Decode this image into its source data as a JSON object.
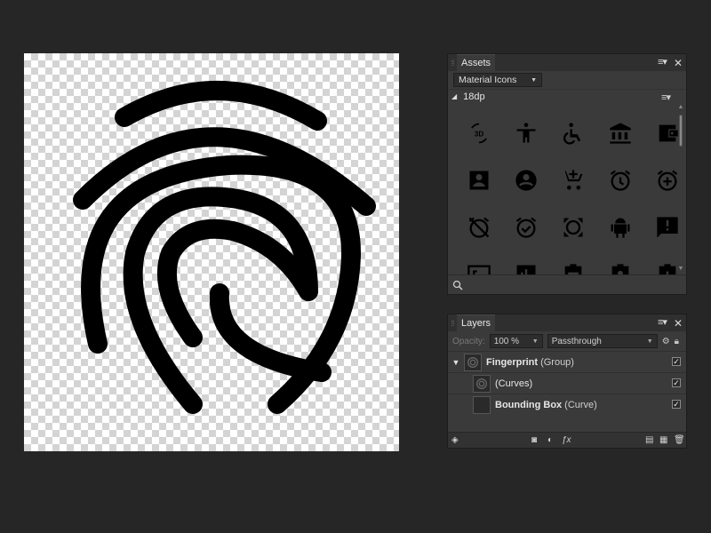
{
  "assets_panel": {
    "tab_label": "Assets",
    "menu_icon": "hamburger-menu-icon",
    "close_icon": "close-icon",
    "library_selected": "Material Icons",
    "category_label": "18dp",
    "icons": [
      "3d-rotation-icon",
      "accessibility-icon",
      "accessible-icon",
      "account-balance-icon",
      "account-balance-wallet-icon",
      "account-box-icon",
      "account-circle-icon",
      "add-shopping-cart-icon",
      "alarm-icon",
      "alarm-add-icon",
      "alarm-off-icon",
      "alarm-on-icon",
      "all-out-icon",
      "android-icon",
      "announcement-icon",
      "aspect-ratio-icon",
      "assessment-icon",
      "assignment-icon",
      "assignment-ind-icon",
      "assignment-late-icon"
    ],
    "search_icon": "search-icon"
  },
  "layers_panel": {
    "tab_label": "Layers",
    "opacity_label": "Opacity:",
    "opacity_value": "100 %",
    "blend_mode": "Passthrough",
    "layers": [
      {
        "name": "Fingerprint",
        "type": "(Group)",
        "bold": true,
        "checked": true
      },
      {
        "name": "",
        "type": "(Curves)",
        "bold": false,
        "checked": true
      },
      {
        "name": "Bounding Box",
        "type": "(Curve)",
        "bold": true,
        "checked": true
      }
    ]
  },
  "canvas": {
    "artwork": "fingerprint-icon",
    "stroke_color": "#000000"
  }
}
